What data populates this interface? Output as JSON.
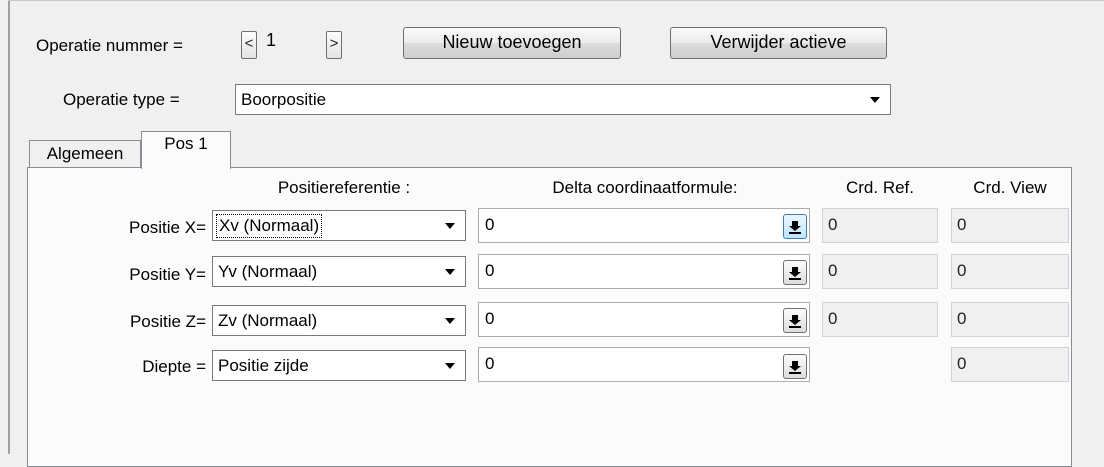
{
  "header": {
    "operation_number_label": "Operatie nummer =",
    "prev_label": "<",
    "operation_number_value": "1",
    "next_label": ">",
    "add_new_label": "Nieuw toevoegen",
    "delete_active_label": "Verwijder actieve",
    "operation_type_label": "Operatie type =",
    "operation_type_value": "Boorpositie"
  },
  "tabs": [
    {
      "label": "Algemeen",
      "active": false
    },
    {
      "label": "Pos 1",
      "active": true
    }
  ],
  "columns": {
    "position_reference": "Positiereferentie :",
    "delta_formula": "Delta coordinaatformule:",
    "crd_ref": "Crd. Ref.",
    "crd_view": "Crd. View"
  },
  "rows": [
    {
      "label": "Positie X=",
      "reference": "Xv (Normaal)",
      "formula": "0",
      "crd_ref": "0",
      "crd_view": "0",
      "formula_button_icon": "arrow-down-bar-icon",
      "button_active": true
    },
    {
      "label": "Positie Y=",
      "reference": "Yv (Normaal)",
      "formula": "0",
      "crd_ref": "0",
      "crd_view": "0",
      "formula_button_icon": "arrow-down-bar-icon",
      "button_active": false
    },
    {
      "label": "Positie Z=",
      "reference": "Zv (Normaal)",
      "formula": "0",
      "crd_ref": "0",
      "crd_view": "0",
      "formula_button_icon": "arrow-down-bar-icon",
      "button_active": false
    },
    {
      "label": "Diepte =",
      "reference": "Positie zijde",
      "formula": "0",
      "crd_ref": null,
      "crd_view": "0",
      "formula_button_icon": "arrow-down-bar-icon",
      "button_active": false
    }
  ]
}
